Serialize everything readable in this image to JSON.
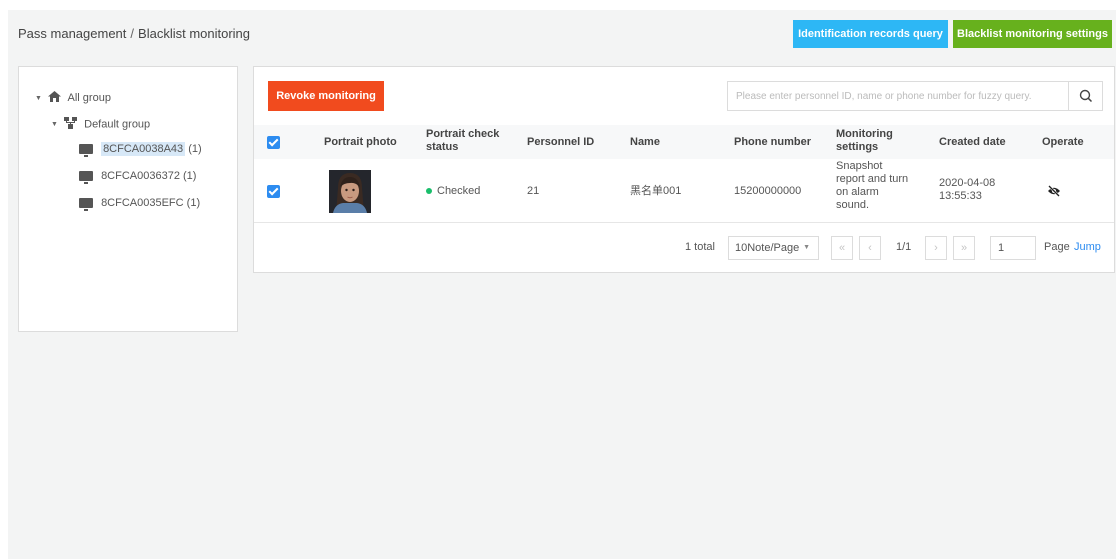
{
  "header": {
    "breadcrumb_parent": "Pass management",
    "breadcrumb_sep": "/",
    "breadcrumb_current": "Blacklist monitoring",
    "btn_identification": "Identification records query",
    "btn_settings": "Blacklist monitoring settings"
  },
  "tree": {
    "root": "All group",
    "group": "Default group",
    "devices": [
      {
        "name": "8CFCA0038A43",
        "count": "(1)"
      },
      {
        "name": "8CFCA0036372",
        "count": "(1)"
      },
      {
        "name": "8CFCA0035EFC",
        "count": "(1)"
      }
    ]
  },
  "toolbar": {
    "revoke": "Revoke monitoring",
    "search_placeholder": "Please enter personnel ID, name or phone number for fuzzy query."
  },
  "table": {
    "columns": {
      "portrait": "Portrait photo",
      "status": "Portrait check status",
      "id": "Personnel ID",
      "name": "Name",
      "phone": "Phone number",
      "monitoring": "Monitoring settings",
      "created": "Created date",
      "operate": "Operate"
    },
    "rows": [
      {
        "status": "Checked",
        "id": "21",
        "name": "黑名单001",
        "phone": "15200000000",
        "monitoring": "Snapshot report and turn on alarm sound.",
        "created_date": "2020-04-08",
        "created_time": "13:55:33"
      }
    ]
  },
  "pager": {
    "total": "1 total",
    "page_size": "10Note/Page",
    "first": "«",
    "prev": "‹",
    "pages": "1/1",
    "next": "›",
    "last": "»",
    "jump_value": "1",
    "page_label": "Page",
    "jump_label": "Jump"
  },
  "colors": {
    "blue_button": "#2db7f5",
    "green_button": "#67b11d",
    "revoke_button": "#f14b1e",
    "checkbox": "#2d8cf0",
    "status_ok": "#19be6b",
    "link": "#2d8cf0"
  },
  "icons": {
    "root": "home-icon",
    "group": "group-icon",
    "device": "monitor-icon",
    "search": "search-icon",
    "operate": "eye-off-icon"
  }
}
